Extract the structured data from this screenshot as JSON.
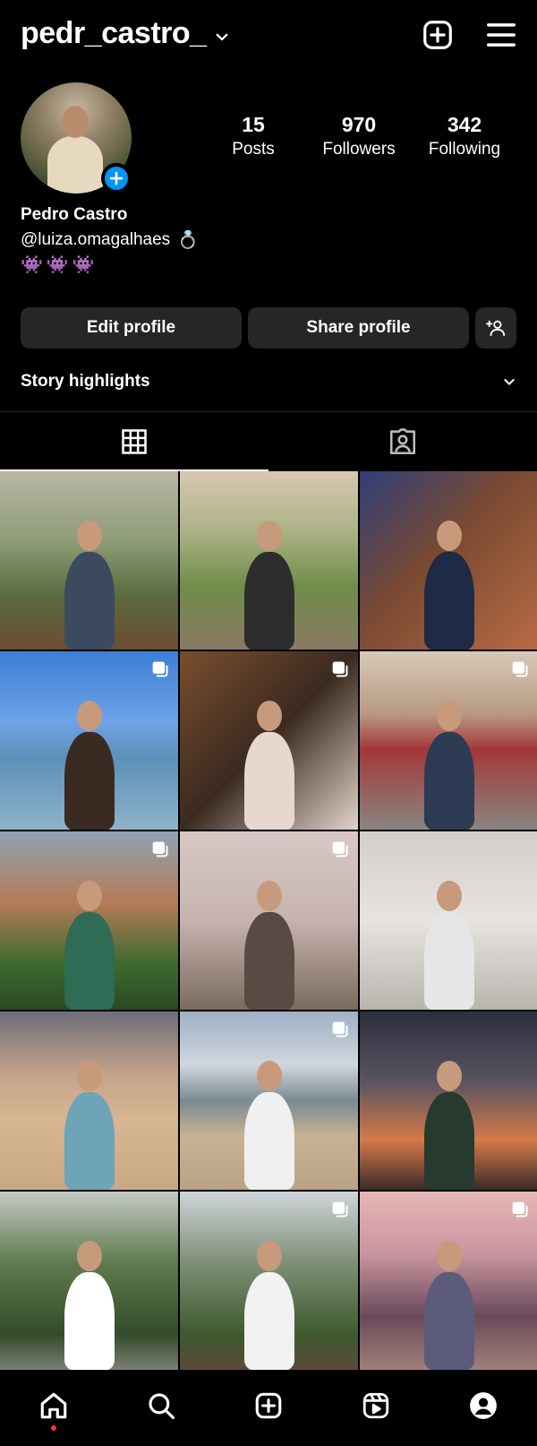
{
  "header": {
    "username": "pedr_castro_",
    "add_icon": "plus-square-icon",
    "menu_icon": "hamburger-menu-icon"
  },
  "profile": {
    "stats": [
      {
        "value": "15",
        "label": "Posts"
      },
      {
        "value": "970",
        "label": "Followers"
      },
      {
        "value": "342",
        "label": "Following"
      }
    ],
    "full_name": "Pedro Castro",
    "bio_mention": "@luiza.omagalhaes",
    "bio_emoji": "💍",
    "emoji_line": "👾👾👾"
  },
  "buttons": {
    "edit": "Edit profile",
    "share": "Share profile",
    "discover_icon": "add-person-icon"
  },
  "highlights": {
    "title": "Story highlights"
  },
  "tabs": [
    {
      "name": "grid",
      "icon": "grid-icon",
      "active": true
    },
    {
      "name": "tagged",
      "icon": "tagged-person-icon",
      "active": false
    }
  ],
  "posts": [
    {
      "multi": false,
      "bg": "linear-gradient(180deg,#b9b7a4 0%,#8d9b77 40%,#5b6a3d 70%,#6b4d34 100%)"
    },
    {
      "multi": false,
      "bg": "linear-gradient(180deg,#d9c8b0 0%,#a9b184 35%,#6f8c49 65%,#8a7a63 100%)"
    },
    {
      "multi": false,
      "bg": "linear-gradient(135deg,#2f3f78 0%,#7a4a32 45%,#b86a45 100%)"
    },
    {
      "multi": true,
      "bg": "linear-gradient(180deg,#3d7fd6 0%,#6ea3e6 40%,#5e90b8 60%,#8fb3c8 100%)"
    },
    {
      "multi": true,
      "bg": "linear-gradient(135deg,#7a4e2e 0%,#3b2a20 50%,#e2d4c9 100%)"
    },
    {
      "multi": true,
      "bg": "linear-gradient(180deg,#d7c9b8 0%,#b89a83 35%,#a3373a 55%,#8a8580 100%)"
    },
    {
      "multi": true,
      "bg": "linear-gradient(180deg,#8fa3b6 0%,#b57b56 40%,#3c6a2e 75%,#2a4a22 100%)"
    },
    {
      "multi": true,
      "bg": "linear-gradient(180deg,#d8c8c5 0%,#c6b3ae 50%,#7a6a5e 100%)"
    },
    {
      "multi": false,
      "bg": "linear-gradient(180deg,#d2cfcb 0%,#e7e4e0 50%,#b8b4ae 100%)"
    },
    {
      "multi": false,
      "bg": "linear-gradient(180deg,#6d6e7a 0%,#c4a38a 35%,#d7b693 60%,#c9a985 100%)"
    },
    {
      "multi": true,
      "bg": "linear-gradient(180deg,#9fb0c6 0%,#cfd6de 30%,#7b8a92 50%,#c7b394 70%,#b8a283 100%)"
    },
    {
      "multi": false,
      "bg": "linear-gradient(180deg,#2b2f3d 0%,#5b5462 40%,#d57a48 72%,#3a2c28 100%)"
    },
    {
      "multi": false,
      "bg": "linear-gradient(180deg,#c6c9c4 0%,#5f7b4e 40%,#334b2a 80%,#7b7f75 100%)"
    },
    {
      "multi": true,
      "bg": "linear-gradient(180deg,#cfd4da 0%,#7e8f76 40%,#3e5a2d 80%,#5a4a3a 100%)"
    },
    {
      "multi": true,
      "bg": "linear-gradient(180deg,#e6b7b4 0%,#c995a0 35%,#6a4a5a 70%,#a0807a 100%)"
    }
  ],
  "nav": [
    {
      "name": "home",
      "icon": "home-icon"
    },
    {
      "name": "search",
      "icon": "search-icon"
    },
    {
      "name": "create",
      "icon": "plus-square-icon"
    },
    {
      "name": "reels",
      "icon": "reels-icon"
    },
    {
      "name": "profile",
      "icon": "profile-icon"
    }
  ]
}
